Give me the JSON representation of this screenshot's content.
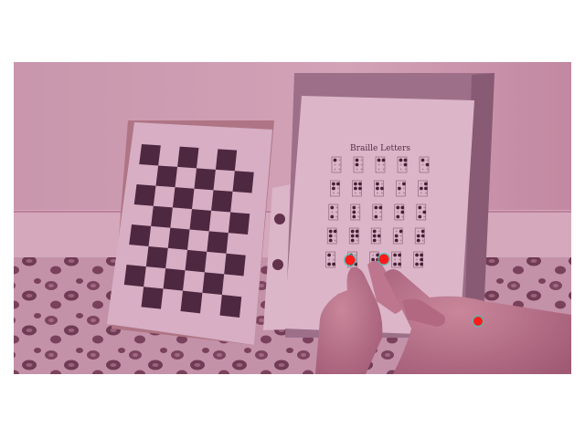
{
  "photo": {
    "sheet_title": "Braille Letters",
    "overlay_color": "#a0356a",
    "marker_color": "#ff1a1a",
    "marker_ring_color": "#39c6b4",
    "braille_cells": [
      [
        "a",
        "b",
        "c",
        "d",
        "e"
      ],
      [
        "f",
        "g",
        "h",
        "i",
        "j"
      ],
      [
        "k",
        "l",
        "m",
        "n",
        "o"
      ],
      [
        "p",
        "q",
        "r",
        "s",
        "t"
      ],
      [
        "u",
        "v",
        "w",
        "x",
        "y"
      ]
    ],
    "braille_dots": {
      "a": [
        1
      ],
      "b": [
        1,
        2
      ],
      "c": [
        1,
        4
      ],
      "d": [
        1,
        4,
        5
      ],
      "e": [
        1,
        5
      ],
      "f": [
        1,
        2,
        4
      ],
      "g": [
        1,
        2,
        4,
        5
      ],
      "h": [
        1,
        2,
        5
      ],
      "i": [
        2,
        4
      ],
      "j": [
        2,
        4,
        5
      ],
      "k": [
        1,
        3
      ],
      "l": [
        1,
        2,
        3
      ],
      "m": [
        1,
        3,
        4
      ],
      "n": [
        1,
        3,
        4,
        5
      ],
      "o": [
        1,
        3,
        5
      ],
      "p": [
        1,
        2,
        3,
        4
      ],
      "q": [
        1,
        2,
        3,
        4,
        5
      ],
      "r": [
        1,
        2,
        3,
        5
      ],
      "s": [
        2,
        3,
        4
      ],
      "t": [
        2,
        3,
        4,
        5
      ],
      "u": [
        1,
        3,
        6
      ],
      "v": [
        1,
        2,
        3,
        6
      ],
      "w": [
        2,
        4,
        5,
        6
      ],
      "x": [
        1,
        3,
        4,
        6
      ],
      "y": [
        1,
        3,
        4,
        5,
        6
      ]
    },
    "tracked_points": 3
  }
}
